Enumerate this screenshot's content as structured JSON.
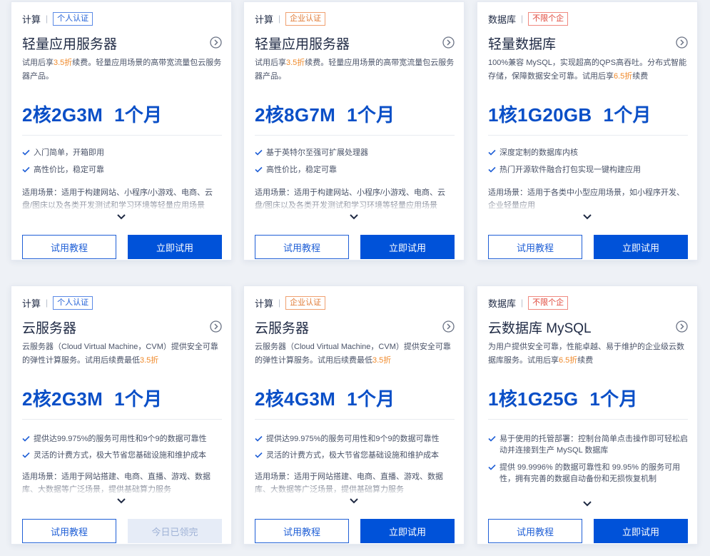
{
  "cards": [
    {
      "category": "计算",
      "badge": "个人认证",
      "title": "轻量应用服务器",
      "desc": [
        "试用后享",
        "3.5折",
        "续费。轻量应用场景的高带宽流量包云服务器产品。"
      ],
      "spec": [
        "2核2G3M",
        "1个月"
      ],
      "features": [
        "入门简单，开箱即用",
        "高性价比，稳定可靠"
      ],
      "scene": "适用场景：适用于构建网站、小程序/小游戏、电商、云盘/图床以及各类开发测试和学习环境等轻量应用场景",
      "btn_left": "试用教程",
      "btn_right": "立即试用"
    },
    {
      "category": "计算",
      "badge": "企业认证",
      "title": "轻量应用服务器",
      "desc": [
        "试用后享",
        "3.5折",
        "续费。轻量应用场景的高带宽流量包云服务器产品。"
      ],
      "spec": [
        "2核8G7M",
        "1个月"
      ],
      "features": [
        "基于英特尔至强可扩展处理器",
        "高性价比，稳定可靠"
      ],
      "scene": "适用场景：适用于构建网站、小程序/小游戏、电商、云盘/图床以及各类开发测试和学习环境等轻量应用场景",
      "btn_left": "试用教程",
      "btn_right": "立即试用"
    },
    {
      "category": "数据库",
      "badge": "不限个企",
      "title": "轻量数据库",
      "desc": [
        "100%兼容 MySQL，实现超高的QPS高吞吐。分布式智能存储，保障数据安全可靠。试用后享",
        "6.5折",
        "续费"
      ],
      "spec": [
        "1核1G20GB",
        "1个月"
      ],
      "features": [
        "深度定制的数据库内核",
        "热门开源软件融合打包实现一键构建应用"
      ],
      "scene": "适用场景：适用于各类中小型应用场景，如小程序开发、企业轻量应用",
      "btn_left": "试用教程",
      "btn_right": "立即试用"
    },
    {
      "category": "计算",
      "badge": "个人认证",
      "title": "云服务器",
      "desc": [
        "云服务器（Cloud Virtual Machine，CVM）提供安全可靠的弹性计算服务。试用后续费最低",
        "3.5折",
        ""
      ],
      "spec": [
        "2核2G3M",
        "1个月"
      ],
      "features": [
        "提供达99.975%的服务可用性和9个9的数据可靠性",
        "灵活的计费方式，极大节省您基础设施和维护成本"
      ],
      "scene": "适用场景：适用于网站搭建、电商、直播、游戏、数据库、大数据等广泛场景，提供基础算力服务",
      "btn_left": "试用教程",
      "btn_right": "今日已领完"
    },
    {
      "category": "计算",
      "badge": "企业认证",
      "title": "云服务器",
      "desc": [
        "云服务器（Cloud Virtual Machine，CVM）提供安全可靠的弹性计算服务。试用后续费最低",
        "3.5折",
        ""
      ],
      "spec": [
        "2核4G3M",
        "1个月"
      ],
      "features": [
        "提供达99.975%的服务可用性和9个9的数据可靠性",
        "灵活的计费方式，极大节省您基础设施和维护成本"
      ],
      "scene": "适用场景：适用于网站搭建、电商、直播、游戏、数据库、大数据等广泛场景，提供基础算力服务",
      "btn_left": "试用教程",
      "btn_right": "立即试用"
    },
    {
      "category": "数据库",
      "badge": "不限个企",
      "title": "云数据库 MySQL",
      "desc": [
        "为用户提供安全可靠，性能卓越、易于维护的企业级云数据库服务。试用后享",
        "6.5折",
        "续费"
      ],
      "spec": [
        "1核1G25G",
        "1个月"
      ],
      "features": [
        "易于使用的托管部署：控制台简单点击操作即可轻松启动并连接到生产 MySQL 数据库",
        "提供 99.9996% 的数据可靠性和 99.95% 的服务可用性，拥有完善的数据自动备份和无损恢复机制"
      ],
      "scene": "",
      "btn_left": "试用教程",
      "btn_right": "立即试用"
    }
  ],
  "colors": {
    "primary": "#0052d9",
    "highlight": "#f08a2b",
    "badge_blue": "#1f5fd6",
    "badge_orange": "#e07a35",
    "badge_red": "#e0473a"
  },
  "icons": {
    "arrow": "circle-arrow-right-icon",
    "check": "check-icon",
    "chevron": "chevron-down-icon"
  }
}
